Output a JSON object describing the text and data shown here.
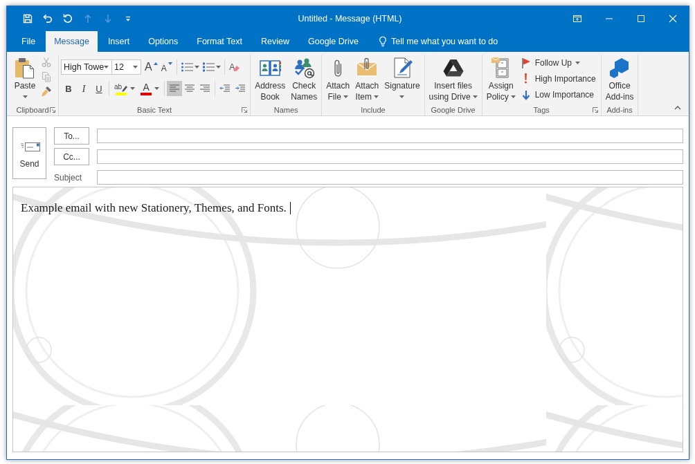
{
  "window": {
    "title": "Untitled - Message (HTML)"
  },
  "quick_access": [
    {
      "kind": "save",
      "disabled": false
    },
    {
      "kind": "undo",
      "disabled": false
    },
    {
      "kind": "redo",
      "disabled": false
    },
    {
      "kind": "up",
      "disabled": true
    },
    {
      "kind": "down",
      "disabled": true
    },
    {
      "kind": "customize",
      "disabled": false
    }
  ],
  "tabs": [
    {
      "label": "File",
      "selected": false
    },
    {
      "label": "Message",
      "selected": true
    },
    {
      "label": "Insert",
      "selected": false
    },
    {
      "label": "Options",
      "selected": false
    },
    {
      "label": "Format Text",
      "selected": false
    },
    {
      "label": "Review",
      "selected": false
    },
    {
      "label": "Google Drive",
      "selected": false
    }
  ],
  "tell_me": {
    "label": "Tell me what you want to do"
  },
  "ribbon": {
    "groups": [
      {
        "kind": "clipboard",
        "label": "Clipboard",
        "launcher": true,
        "buttons": [
          {
            "kind": "paste",
            "lines": [
              "Paste"
            ],
            "menu": true
          }
        ],
        "small_tools": [
          {
            "kind": "cut",
            "disabled": true
          },
          {
            "kind": "copy",
            "disabled": true
          },
          {
            "kind": "format-painter",
            "disabled": false
          }
        ]
      },
      {
        "kind": "basic_text",
        "label": "Basic Text",
        "launcher": true,
        "font_name": "High Towe",
        "font_size": "12",
        "size_tools": [
          {
            "kind": "grow",
            "glyph": "A"
          },
          {
            "kind": "shrink",
            "glyph": "A"
          }
        ],
        "clear_glyph": "A",
        "styles": [
          {
            "kind": "bold",
            "glyph": "B"
          },
          {
            "kind": "italic",
            "glyph": "I"
          },
          {
            "kind": "underline",
            "glyph": "U"
          }
        ],
        "colors": [
          {
            "kind": "highlight",
            "glyph": "ab"
          },
          {
            "kind": "font-color",
            "glyph": "A"
          }
        ],
        "alignment": [
          {
            "kind": "left",
            "selected": true
          },
          {
            "kind": "center",
            "selected": false
          },
          {
            "kind": "right",
            "selected": false
          }
        ]
      },
      {
        "kind": "large",
        "label": "Names",
        "launcher": false,
        "buttons": [
          {
            "kind": "address-book",
            "lines": [
              "Address",
              "Book"
            ],
            "menu": false
          },
          {
            "kind": "check-names",
            "lines": [
              "Check",
              "Names"
            ],
            "menu": false
          }
        ]
      },
      {
        "kind": "large",
        "label": "Include",
        "launcher": false,
        "buttons": [
          {
            "kind": "attach-file",
            "lines": [
              "Attach",
              "File"
            ],
            "menu": true
          },
          {
            "kind": "attach-item",
            "lines": [
              "Attach",
              "Item"
            ],
            "menu": true
          },
          {
            "kind": "signature",
            "lines": [
              "Signature"
            ],
            "menu": true
          }
        ]
      },
      {
        "kind": "large",
        "label": "Google Drive",
        "launcher": false,
        "buttons": [
          {
            "kind": "drive",
            "lines": [
              "Insert files",
              "using Drive"
            ],
            "menu": true
          }
        ]
      },
      {
        "kind": "tags",
        "label": "Tags",
        "launcher": true,
        "buttons": [
          {
            "kind": "assign-policy",
            "lines": [
              "Assign",
              "Policy"
            ],
            "menu": true
          }
        ],
        "small_buttons": [
          {
            "kind": "follow-up",
            "label": "Follow Up",
            "menu": true
          },
          {
            "kind": "high-importance",
            "label": "High Importance",
            "menu": false
          },
          {
            "kind": "low-importance",
            "label": "Low Importance",
            "menu": false
          }
        ]
      },
      {
        "kind": "large",
        "label": "Add-ins",
        "launcher": false,
        "buttons": [
          {
            "kind": "office-add-ins",
            "lines": [
              "Office",
              "Add-ins"
            ],
            "menu": false
          }
        ]
      }
    ]
  },
  "compose": {
    "send": "Send",
    "recipients": [
      {
        "button": "To..."
      },
      {
        "button": "Cc..."
      }
    ],
    "subject_label": "Subject"
  },
  "body": {
    "text": "Example email with new Stationery, Themes, and Fonts.",
    "cursor": true
  }
}
